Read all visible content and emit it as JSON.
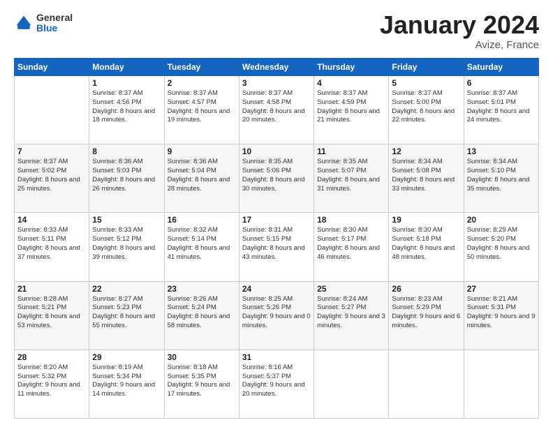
{
  "logo": {
    "general": "General",
    "blue": "Blue"
  },
  "title": {
    "month_year": "January 2024",
    "location": "Avize, France"
  },
  "weekdays": [
    "Sunday",
    "Monday",
    "Tuesday",
    "Wednesday",
    "Thursday",
    "Friday",
    "Saturday"
  ],
  "weeks": [
    [
      {
        "day": "",
        "sunrise": "",
        "sunset": "",
        "daylight": ""
      },
      {
        "day": "1",
        "sunrise": "Sunrise: 8:37 AM",
        "sunset": "Sunset: 4:56 PM",
        "daylight": "Daylight: 8 hours and 18 minutes."
      },
      {
        "day": "2",
        "sunrise": "Sunrise: 8:37 AM",
        "sunset": "Sunset: 4:57 PM",
        "daylight": "Daylight: 8 hours and 19 minutes."
      },
      {
        "day": "3",
        "sunrise": "Sunrise: 8:37 AM",
        "sunset": "Sunset: 4:58 PM",
        "daylight": "Daylight: 8 hours and 20 minutes."
      },
      {
        "day": "4",
        "sunrise": "Sunrise: 8:37 AM",
        "sunset": "Sunset: 4:59 PM",
        "daylight": "Daylight: 8 hours and 21 minutes."
      },
      {
        "day": "5",
        "sunrise": "Sunrise: 8:37 AM",
        "sunset": "Sunset: 5:00 PM",
        "daylight": "Daylight: 8 hours and 22 minutes."
      },
      {
        "day": "6",
        "sunrise": "Sunrise: 8:37 AM",
        "sunset": "Sunset: 5:01 PM",
        "daylight": "Daylight: 8 hours and 24 minutes."
      }
    ],
    [
      {
        "day": "7",
        "sunrise": "Sunrise: 8:37 AM",
        "sunset": "Sunset: 5:02 PM",
        "daylight": "Daylight: 8 hours and 25 minutes."
      },
      {
        "day": "8",
        "sunrise": "Sunrise: 8:36 AM",
        "sunset": "Sunset: 5:03 PM",
        "daylight": "Daylight: 8 hours and 26 minutes."
      },
      {
        "day": "9",
        "sunrise": "Sunrise: 8:36 AM",
        "sunset": "Sunset: 5:04 PM",
        "daylight": "Daylight: 8 hours and 28 minutes."
      },
      {
        "day": "10",
        "sunrise": "Sunrise: 8:35 AM",
        "sunset": "Sunset: 5:06 PM",
        "daylight": "Daylight: 8 hours and 30 minutes."
      },
      {
        "day": "11",
        "sunrise": "Sunrise: 8:35 AM",
        "sunset": "Sunset: 5:07 PM",
        "daylight": "Daylight: 8 hours and 31 minutes."
      },
      {
        "day": "12",
        "sunrise": "Sunrise: 8:34 AM",
        "sunset": "Sunset: 5:08 PM",
        "daylight": "Daylight: 8 hours and 33 minutes."
      },
      {
        "day": "13",
        "sunrise": "Sunrise: 8:34 AM",
        "sunset": "Sunset: 5:10 PM",
        "daylight": "Daylight: 8 hours and 35 minutes."
      }
    ],
    [
      {
        "day": "14",
        "sunrise": "Sunrise: 8:33 AM",
        "sunset": "Sunset: 5:11 PM",
        "daylight": "Daylight: 8 hours and 37 minutes."
      },
      {
        "day": "15",
        "sunrise": "Sunrise: 8:33 AM",
        "sunset": "Sunset: 5:12 PM",
        "daylight": "Daylight: 8 hours and 39 minutes."
      },
      {
        "day": "16",
        "sunrise": "Sunrise: 8:32 AM",
        "sunset": "Sunset: 5:14 PM",
        "daylight": "Daylight: 8 hours and 41 minutes."
      },
      {
        "day": "17",
        "sunrise": "Sunrise: 8:31 AM",
        "sunset": "Sunset: 5:15 PM",
        "daylight": "Daylight: 8 hours and 43 minutes."
      },
      {
        "day": "18",
        "sunrise": "Sunrise: 8:30 AM",
        "sunset": "Sunset: 5:17 PM",
        "daylight": "Daylight: 8 hours and 46 minutes."
      },
      {
        "day": "19",
        "sunrise": "Sunrise: 8:30 AM",
        "sunset": "Sunset: 5:18 PM",
        "daylight": "Daylight: 8 hours and 48 minutes."
      },
      {
        "day": "20",
        "sunrise": "Sunrise: 8:29 AM",
        "sunset": "Sunset: 5:20 PM",
        "daylight": "Daylight: 8 hours and 50 minutes."
      }
    ],
    [
      {
        "day": "21",
        "sunrise": "Sunrise: 8:28 AM",
        "sunset": "Sunset: 5:21 PM",
        "daylight": "Daylight: 8 hours and 53 minutes."
      },
      {
        "day": "22",
        "sunrise": "Sunrise: 8:27 AM",
        "sunset": "Sunset: 5:23 PM",
        "daylight": "Daylight: 8 hours and 55 minutes."
      },
      {
        "day": "23",
        "sunrise": "Sunrise: 8:26 AM",
        "sunset": "Sunset: 5:24 PM",
        "daylight": "Daylight: 8 hours and 58 minutes."
      },
      {
        "day": "24",
        "sunrise": "Sunrise: 8:25 AM",
        "sunset": "Sunset: 5:26 PM",
        "daylight": "Daylight: 9 hours and 0 minutes."
      },
      {
        "day": "25",
        "sunrise": "Sunrise: 8:24 AM",
        "sunset": "Sunset: 5:27 PM",
        "daylight": "Daylight: 9 hours and 3 minutes."
      },
      {
        "day": "26",
        "sunrise": "Sunrise: 8:23 AM",
        "sunset": "Sunset: 5:29 PM",
        "daylight": "Daylight: 9 hours and 6 minutes."
      },
      {
        "day": "27",
        "sunrise": "Sunrise: 8:21 AM",
        "sunset": "Sunset: 5:31 PM",
        "daylight": "Daylight: 9 hours and 9 minutes."
      }
    ],
    [
      {
        "day": "28",
        "sunrise": "Sunrise: 8:20 AM",
        "sunset": "Sunset: 5:32 PM",
        "daylight": "Daylight: 9 hours and 11 minutes."
      },
      {
        "day": "29",
        "sunrise": "Sunrise: 8:19 AM",
        "sunset": "Sunset: 5:34 PM",
        "daylight": "Daylight: 9 hours and 14 minutes."
      },
      {
        "day": "30",
        "sunrise": "Sunrise: 8:18 AM",
        "sunset": "Sunset: 5:35 PM",
        "daylight": "Daylight: 9 hours and 17 minutes."
      },
      {
        "day": "31",
        "sunrise": "Sunrise: 8:16 AM",
        "sunset": "Sunset: 5:37 PM",
        "daylight": "Daylight: 9 hours and 20 minutes."
      },
      {
        "day": "",
        "sunrise": "",
        "sunset": "",
        "daylight": ""
      },
      {
        "day": "",
        "sunrise": "",
        "sunset": "",
        "daylight": ""
      },
      {
        "day": "",
        "sunrise": "",
        "sunset": "",
        "daylight": ""
      }
    ]
  ]
}
